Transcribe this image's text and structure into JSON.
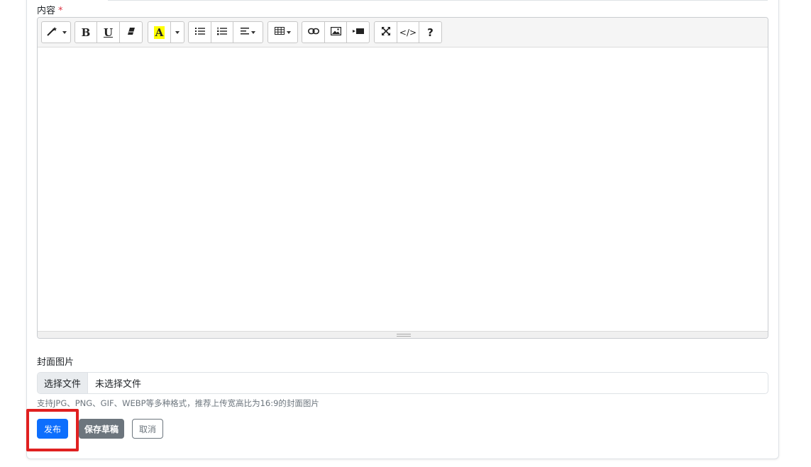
{
  "form": {
    "content_label": "内容",
    "required_mark": "*",
    "cover_label": "封面图片",
    "file_choose_label": "选择文件",
    "file_status": "未选择文件",
    "cover_help": "支持JPG、PNG、GIF、WEBP等多种格式，推荐上传宽高比为16:9的封面图片"
  },
  "toolbar": {
    "bold": "B",
    "underline": "U",
    "color": "A",
    "help": "?",
    "codeview": "</>"
  },
  "actions": {
    "publish": "发布",
    "save_draft": "保存草稿",
    "cancel": "取消"
  },
  "colors": {
    "primary": "#0d6efd",
    "secondary": "#6c757d",
    "required": "#dc3545",
    "highlight_box": "#e02020",
    "color_swatch": "#ffff00"
  },
  "icons": [
    "magic-wand-icon",
    "eraser-icon",
    "bullet-list-icon",
    "numbered-list-icon",
    "align-icon",
    "table-icon",
    "link-icon",
    "image-icon",
    "video-icon",
    "fullscreen-icon",
    "code-view-icon",
    "help-icon"
  ]
}
